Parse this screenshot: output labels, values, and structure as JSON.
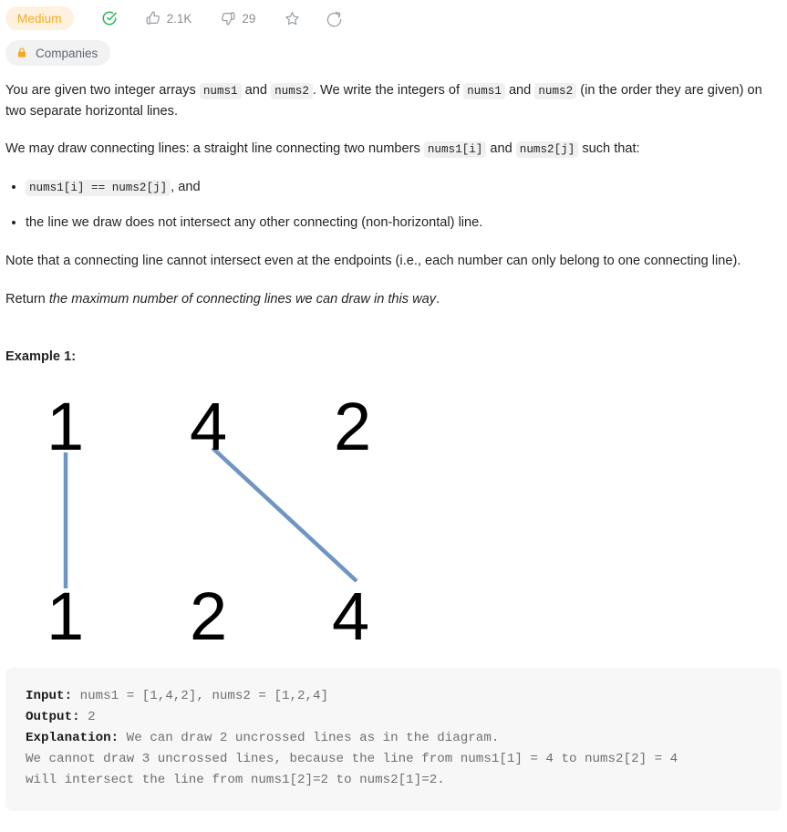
{
  "header": {
    "difficulty": "Medium",
    "solved_icon": "circle-check-icon",
    "likes_icon": "thumbs-up-icon",
    "likes": "2.1K",
    "dislikes_icon": "thumbs-down-icon",
    "dislikes": "29",
    "favorite_icon": "star-icon",
    "share_icon": "share-icon",
    "companies_lock_icon": "lock-icon",
    "companies_label": "Companies"
  },
  "content": {
    "p1_a": "You are given two integer arrays ",
    "p1_code1": "nums1",
    "p1_b": " and ",
    "p1_code2": "nums2",
    "p1_c": ". We write the integers of ",
    "p1_code3": "nums1",
    "p1_d": " and ",
    "p1_code4": "nums2",
    "p1_e": " (in the order they are given) on two separate horizontal lines.",
    "p2_a": "We may draw connecting lines: a straight line connecting two numbers ",
    "p2_code1": "nums1[i]",
    "p2_b": " and ",
    "p2_code2": "nums2[j]",
    "p2_c": " such that:",
    "bullet1_code": "nums1[i] == nums2[j]",
    "bullet1_tail": ", and",
    "bullet2": "the line we draw does not intersect any other connecting (non-horizontal) line.",
    "p3": "Note that a connecting line cannot intersect even at the endpoints (i.e., each number can only belong to one connecting line).",
    "p4_a": "Return ",
    "p4_em": "the maximum number of connecting lines we can draw in this way",
    "p4_b": ".",
    "example_title": "Example 1:"
  },
  "diagram": {
    "top_row": [
      "1",
      "4",
      "2"
    ],
    "bottom_row": [
      "1",
      "2",
      "4"
    ],
    "line_color": "#6e96c4",
    "connections": [
      "top[0]-bottom[0]",
      "top[1]-bottom[2]"
    ]
  },
  "example": {
    "input_label": "Input:",
    "input_value": " nums1 = [1,4,2], nums2 = [1,2,4]",
    "output_label": "Output:",
    "output_value": " 2",
    "explanation_label": "Explanation:",
    "explanation_value": " We can draw 2 uncrossed lines as in the diagram.",
    "explanation_line2": "We cannot draw 3 uncrossed lines, because the line from nums1[1] = 4 to nums2[2] = 4",
    "explanation_line3": "will intersect the line from nums1[2]=2 to nums2[1]=2."
  }
}
